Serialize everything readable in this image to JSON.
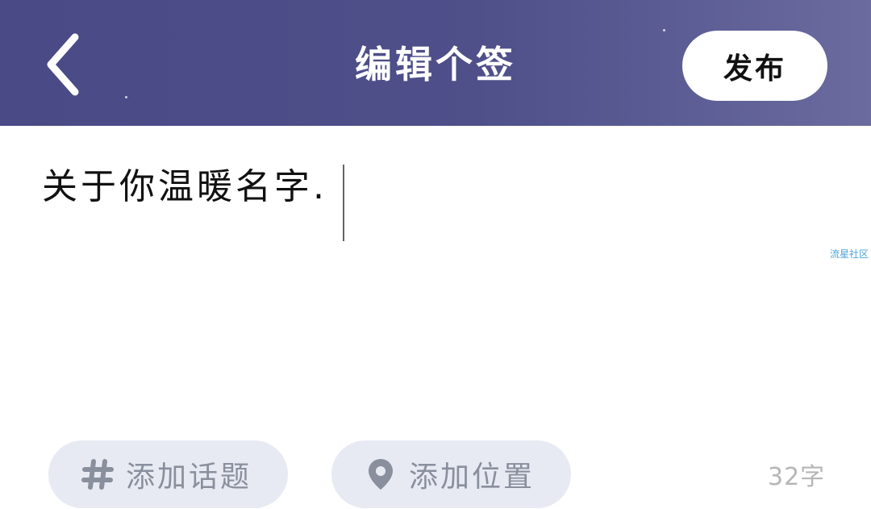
{
  "header": {
    "title": "编辑个签",
    "publish_label": "发布",
    "back_icon": "chevron-left-icon",
    "background_colors": [
      "#494a86",
      "#6b6b9f"
    ]
  },
  "editor": {
    "text": "关于你温暖名字.",
    "watermark": "流星社区"
  },
  "footer": {
    "topic_icon": "hash-icon",
    "topic_label": "添加话题",
    "location_icon": "location-pin-icon",
    "location_label": "添加位置",
    "char_count": "32字",
    "chip_color": "#e7eaf2"
  }
}
